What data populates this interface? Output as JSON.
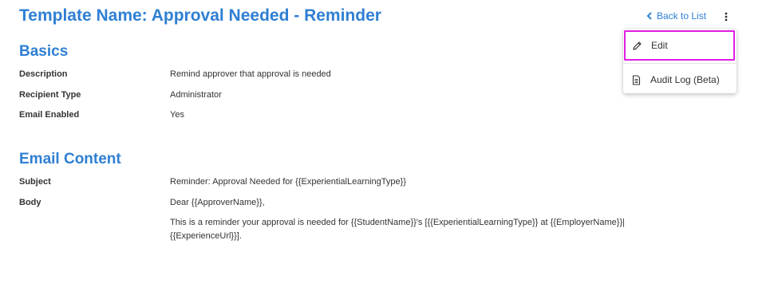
{
  "header": {
    "title": "Template Name: Approval Needed - Reminder",
    "back_label": "Back to List"
  },
  "menu": {
    "items": [
      {
        "label": "Edit",
        "icon": "pencil-icon"
      },
      {
        "label": "Audit Log (Beta)",
        "icon": "document-icon"
      }
    ]
  },
  "basics": {
    "heading": "Basics",
    "fields": [
      {
        "label": "Description",
        "value": "Remind approver that approval is needed"
      },
      {
        "label": "Recipient Type",
        "value": "Administrator"
      },
      {
        "label": "Email Enabled",
        "value": "Yes"
      }
    ]
  },
  "email_content": {
    "heading": "Email Content",
    "subject_label": "Subject",
    "subject_value": "Reminder: Approval Needed for {{ExperientialLearningType}}",
    "body_label": "Body",
    "body_greeting": "Dear {{ApproverName}},",
    "body_line1": "This is a reminder your approval is needed for {{StudentName}}'s [{{ExperientialLearningType}} at {{EmployerName}}|",
    "body_line2": "{{ExperienceUrl}}]."
  },
  "colors": {
    "accent": "#2f7fd3",
    "highlight": "#e11de5",
    "text": "#333333"
  }
}
